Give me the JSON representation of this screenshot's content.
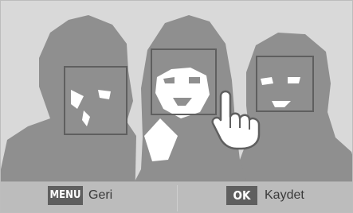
{
  "bottom_bar": {
    "back_key": "MENU",
    "back_label": "Geri",
    "save_key": "OK",
    "save_label": "Kaydet"
  },
  "icons": {
    "touch": "touch-hand-icon"
  },
  "colors": {
    "background": "#d9d9d9",
    "silhouette": "#8f8f8f",
    "face_box": "#5f5f5f",
    "bar": "#bcbcbc",
    "key": "#5f5f5f"
  }
}
